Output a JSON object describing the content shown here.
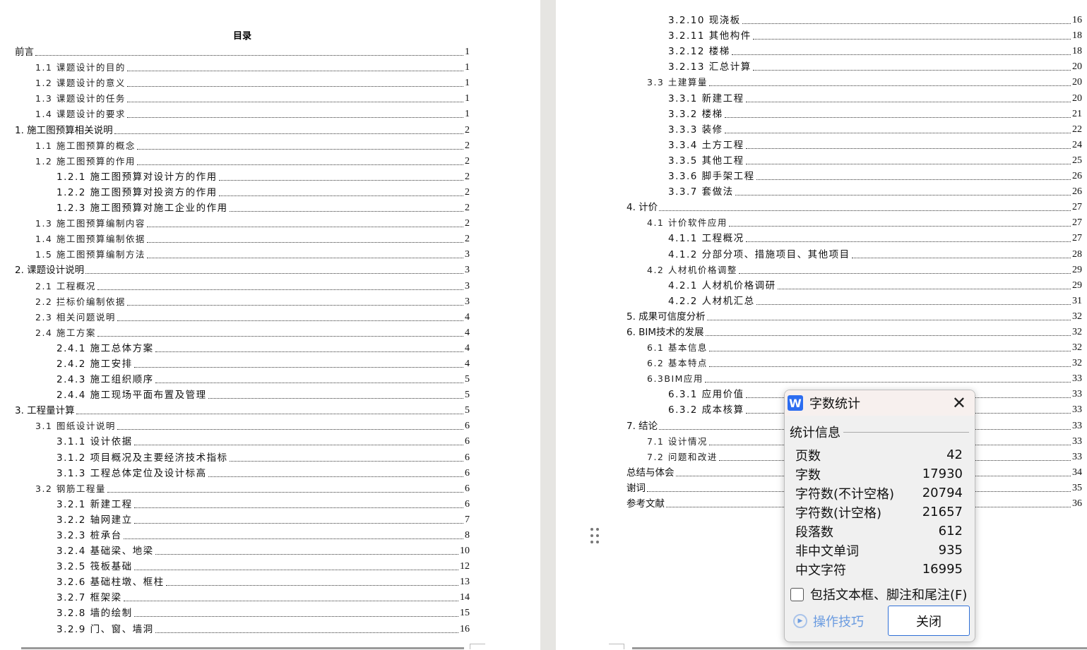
{
  "toc_title": "目录",
  "left_entries": [
    {
      "t": "前言",
      "p": "1",
      "l": 0
    },
    {
      "t": "1.1 课题设计的目的",
      "p": "1",
      "l": 1
    },
    {
      "t": "1.2 课题设计的意义",
      "p": "1",
      "l": 1
    },
    {
      "t": "1.3 课题设计的任务",
      "p": "1",
      "l": 1
    },
    {
      "t": "1.4 课题设计的要求",
      "p": "1",
      "l": 1
    },
    {
      "t": "1.  施工图预算相关说明",
      "p": "2",
      "l": 0
    },
    {
      "t": "1.1 施工图预算的概念",
      "p": "2",
      "l": 1
    },
    {
      "t": "1.2 施工图预算的作用",
      "p": "2",
      "l": 1
    },
    {
      "t": "1.2.1 施工图预算对设计方的作用",
      "p": "2",
      "l": 2
    },
    {
      "t": "1.2.2 施工图预算对投资方的作用",
      "p": "2",
      "l": 2
    },
    {
      "t": "1.2.3 施工图预算对施工企业的作用",
      "p": "2",
      "l": 2
    },
    {
      "t": "1.3 施工图预算编制内容",
      "p": "2",
      "l": 1
    },
    {
      "t": "1.4 施工图预算编制依据",
      "p": "2",
      "l": 1
    },
    {
      "t": "1.5 施工图预算编制方法",
      "p": "3",
      "l": 1
    },
    {
      "t": "2. 课题设计说明",
      "p": "3",
      "l": 0
    },
    {
      "t": "2.1 工程概况",
      "p": "3",
      "l": 1
    },
    {
      "t": "2.2 拦标价编制依据",
      "p": "3",
      "l": 1
    },
    {
      "t": "2.3 相关问题说明",
      "p": "4",
      "l": 1
    },
    {
      "t": "2.4 施工方案",
      "p": "4",
      "l": 1
    },
    {
      "t": "2.4.1 施工总体方案",
      "p": "4",
      "l": 2
    },
    {
      "t": "2.4.2 施工安排",
      "p": "4",
      "l": 2
    },
    {
      "t": "2.4.3 施工组织顺序",
      "p": "5",
      "l": 2
    },
    {
      "t": "2.4.4 施工现场平面布置及管理",
      "p": "5",
      "l": 2
    },
    {
      "t": "3. 工程量计算",
      "p": "5",
      "l": 0
    },
    {
      "t": "3.1 图纸设计说明",
      "p": "6",
      "l": 1
    },
    {
      "t": "3.1.1 设计依据",
      "p": "6",
      "l": 2
    },
    {
      "t": "3.1.2 项目概况及主要经济技术指标",
      "p": "6",
      "l": 2
    },
    {
      "t": "3.1.3 工程总体定位及设计标高",
      "p": "6",
      "l": 2
    },
    {
      "t": "3.2 钢筋工程量",
      "p": "6",
      "l": 1
    },
    {
      "t": "3.2.1 新建工程",
      "p": "6",
      "l": 2
    },
    {
      "t": "3.2.2 轴网建立",
      "p": "7",
      "l": 2
    },
    {
      "t": "3.2.3 桩承台",
      "p": "8",
      "l": 2
    },
    {
      "t": "3.2.4 基础梁、地梁",
      "p": "10",
      "l": 2
    },
    {
      "t": "3.2.5 筏板基础",
      "p": "12",
      "l": 2
    },
    {
      "t": "3.2.6 基础柱墩、框柱",
      "p": "13",
      "l": 2
    },
    {
      "t": "3.2.7 框架梁",
      "p": "14",
      "l": 2
    },
    {
      "t": "3.2.8 墙的绘制",
      "p": "15",
      "l": 2
    },
    {
      "t": "3.2.9 门、窗、墙洞",
      "p": "16",
      "l": 2
    }
  ],
  "right_entries": [
    {
      "t": "3.2.10 现浇板",
      "p": "16",
      "l": 2
    },
    {
      "t": "3.2.11 其他构件",
      "p": "18",
      "l": 2
    },
    {
      "t": "3.2.12 楼梯",
      "p": "18",
      "l": 2
    },
    {
      "t": "3.2.13 汇总计算",
      "p": "20",
      "l": 2
    },
    {
      "t": "3.3 土建算量",
      "p": "20",
      "l": 1
    },
    {
      "t": "3.3.1 新建工程",
      "p": "20",
      "l": 2
    },
    {
      "t": "3.3.2 楼梯",
      "p": "21",
      "l": 2
    },
    {
      "t": "3.3.3 装修",
      "p": "22",
      "l": 2
    },
    {
      "t": "3.3.4 土方工程",
      "p": "24",
      "l": 2
    },
    {
      "t": "3.3.5 其他工程",
      "p": "25",
      "l": 2
    },
    {
      "t": "3.3.6 脚手架工程",
      "p": "26",
      "l": 2
    },
    {
      "t": "3.3.7 套做法",
      "p": "26",
      "l": 2
    },
    {
      "t": "4. 计价",
      "p": "27",
      "l": 0
    },
    {
      "t": "4.1 计价软件应用",
      "p": "27",
      "l": 1
    },
    {
      "t": "4.1.1 工程概况",
      "p": "27",
      "l": 2
    },
    {
      "t": "4.1.2 分部分项、措施项目、其他项目",
      "p": "28",
      "l": 2
    },
    {
      "t": "4.2 人材机价格调整",
      "p": "29",
      "l": 1
    },
    {
      "t": "4.2.1 人材机价格调研",
      "p": "29",
      "l": 2
    },
    {
      "t": "4.2.2 人材机汇总",
      "p": "31",
      "l": 2
    },
    {
      "t": "5.  成果可信度分析",
      "p": "32",
      "l": 0
    },
    {
      "t": "6.  BIM技术的发展",
      "p": "32",
      "l": 0
    },
    {
      "t": "6.1 基本信息",
      "p": "32",
      "l": 1
    },
    {
      "t": "6.2 基本特点",
      "p": "32",
      "l": 1
    },
    {
      "t": "6.3BIM应用",
      "p": "33",
      "l": 1
    },
    {
      "t": "6.3.1 应用价值",
      "p": "33",
      "l": 2
    },
    {
      "t": "6.3.2 成本核算",
      "p": "33",
      "l": 2
    },
    {
      "t": "7. 结论",
      "p": "33",
      "l": 0
    },
    {
      "t": "7.1 设计情况",
      "p": "33",
      "l": 1
    },
    {
      "t": "7.2 问题和改进",
      "p": "33",
      "l": 1
    },
    {
      "t": "总结与体会",
      "p": "34",
      "l": 0
    },
    {
      "t": "谢词",
      "p": "35",
      "l": 0
    },
    {
      "t": "参考文献",
      "p": "36",
      "l": 0
    }
  ],
  "dialog": {
    "icon_letter": "W",
    "title": "字数统计",
    "close_glyph": "✕",
    "group_label": "统计信息",
    "stats": [
      {
        "label": "页数",
        "value": "42"
      },
      {
        "label": "字数",
        "value": "17930"
      },
      {
        "label": "字符数(不计空格)",
        "value": "20794"
      },
      {
        "label": "字符数(计空格)",
        "value": "21657"
      },
      {
        "label": "段落数",
        "value": "612"
      },
      {
        "label": "非中文单词",
        "value": "935"
      },
      {
        "label": "中文字符",
        "value": "16995"
      }
    ],
    "checkbox_label": "包括文本框、脚注和尾注(F)",
    "checkbox_checked": false,
    "tips_label": "操作技巧",
    "close_button": "关闭"
  }
}
